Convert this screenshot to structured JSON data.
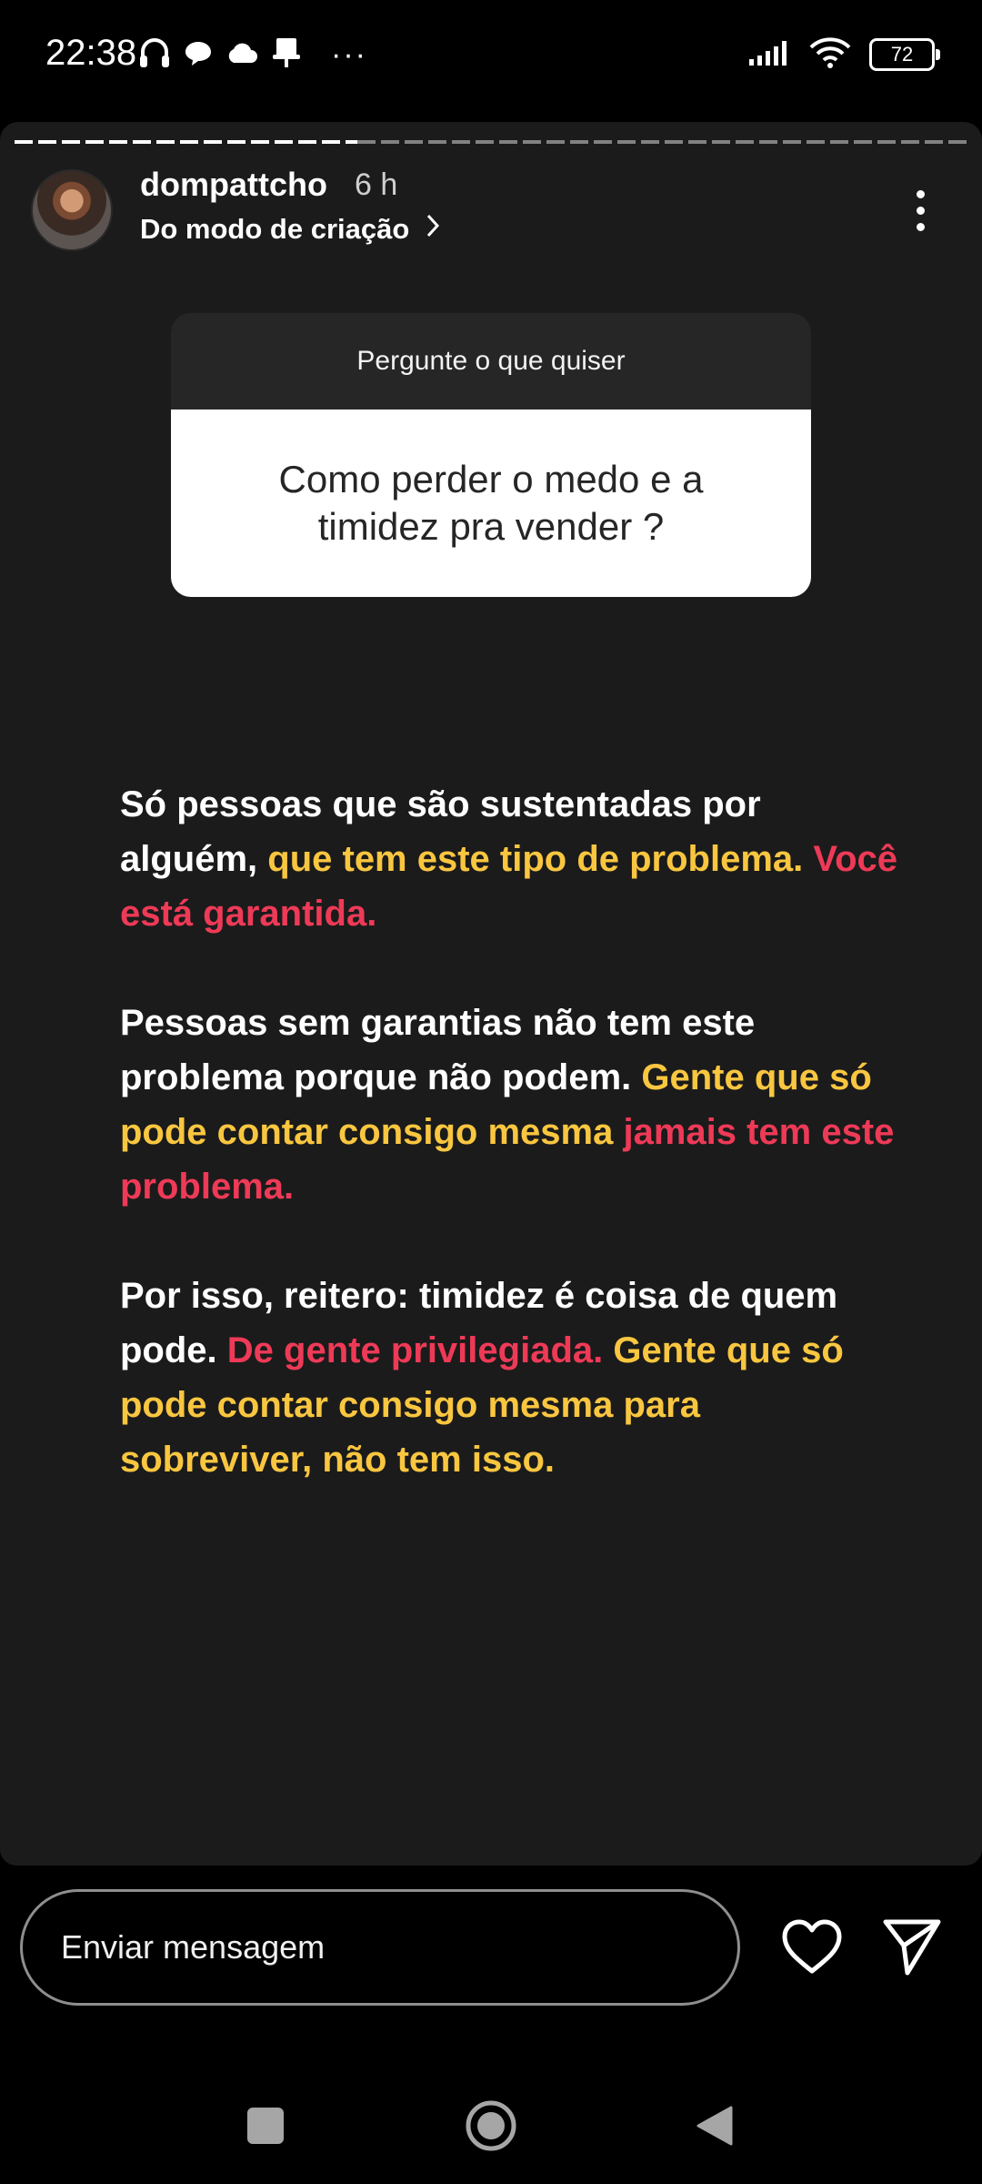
{
  "status_bar": {
    "time": "22:38",
    "left_icons": [
      "headphones-icon",
      "chat-bubble-icon",
      "cloud-icon",
      "pin-icon",
      "more-notifications-icon"
    ],
    "more_notifications": "···",
    "right_icons": [
      "signal-icon",
      "wifi-icon",
      "battery-icon"
    ],
    "battery_level": "72"
  },
  "story": {
    "progress_fraction": 0.36,
    "username": "dompattcho",
    "time_ago": "6 h",
    "subtitle": "Do modo de criação",
    "question_sticker": {
      "header": "Pergunte o que quiser",
      "question": "Como perder o medo e a timidez pra vender ?"
    },
    "paragraphs": [
      [
        {
          "text": "Só pessoas que são sustentadas por alguém, ",
          "color": "white"
        },
        {
          "text": "que tem este tipo de problema.",
          "color": "yellow"
        },
        {
          "text": " ",
          "color": "white"
        },
        {
          "text": "Você está garantida.",
          "color": "red"
        }
      ],
      [
        {
          "text": "Pessoas sem garantias não tem este problema porque não podem. ",
          "color": "white"
        },
        {
          "text": "Gente que só pode contar consigo mesma",
          "color": "yellow"
        },
        {
          "text": " ",
          "color": "white"
        },
        {
          "text": "jamais tem este problema.",
          "color": "red"
        }
      ],
      [
        {
          "text": "Por isso, reitero: timidez é coisa de quem pode. ",
          "color": "white"
        },
        {
          "text": "De gente privilegiada.",
          "color": "red"
        },
        {
          "text": " ",
          "color": "white"
        },
        {
          "text": "Gente que só pode contar consigo mesma para sobreviver, não tem isso.",
          "color": "yellow"
        }
      ]
    ],
    "colors": {
      "white": "#ffffff",
      "yellow": "#f9c640",
      "red": "#ee3a57",
      "background": "#1b1b1b"
    }
  },
  "bottom_bar": {
    "message_placeholder": "Enviar mensagem",
    "like_icon": "heart-icon",
    "send_icon": "send-icon"
  },
  "nav_bar": {
    "icons": [
      "recents-icon",
      "home-icon",
      "back-icon"
    ]
  }
}
